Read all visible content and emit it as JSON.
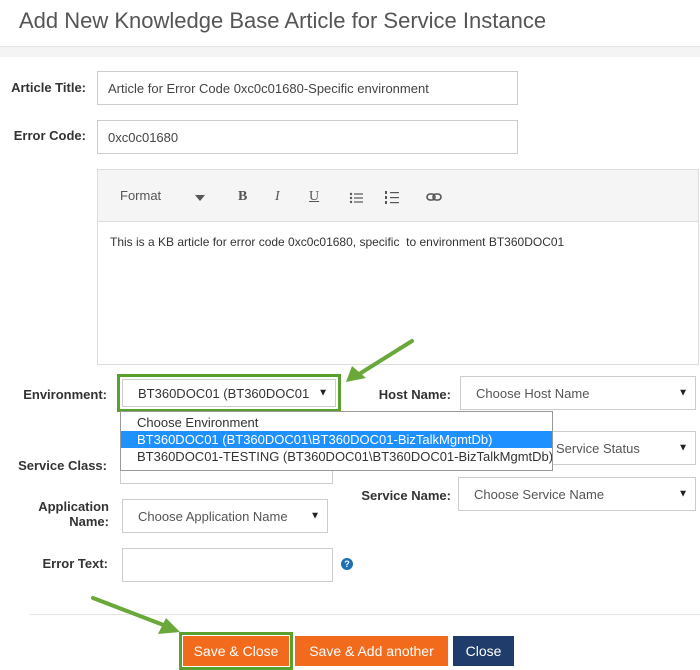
{
  "dialog": {
    "title": "Add New Knowledge Base Article for Service Instance"
  },
  "form": {
    "article_title": {
      "label": "Article Title:",
      "value": "Article for Error Code 0xc0c01680-Specific environment"
    },
    "error_code": {
      "label": "Error Code:",
      "value": "0xc0c01680"
    },
    "editor": {
      "format_label": "Format",
      "bold_glyph": "B",
      "italic_glyph": "I",
      "underline_glyph": "U",
      "content": "This is a KB article for error code 0xc0c01680, specific  to environment BT360DOC01"
    },
    "environment": {
      "label": "Environment:",
      "selected": "BT360DOC01 (BT360DOC01",
      "options": [
        "Choose Environment",
        "BT360DOC01 (BT360DOC01\\BT360DOC01-BizTalkMgmtDb)",
        "BT360DOC01-TESTING (BT360DOC01\\BT360DOC01-BizTalkMgmtDb)"
      ],
      "highlighted_index": 1
    },
    "host_name": {
      "label": "Host Name:",
      "placeholder": "Choose Host Name"
    },
    "service_class": {
      "label": "Service Class:"
    },
    "service_status": {
      "placeholder": "Service Status"
    },
    "service_name": {
      "label": "Service Name:",
      "placeholder": "Choose Service Name"
    },
    "application_name": {
      "label_line1": "Application",
      "label_line2": "Name:",
      "placeholder": "Choose Application Name"
    },
    "error_text": {
      "label": "Error Text:",
      "help_glyph": "?"
    }
  },
  "buttons": {
    "save_close": "Save & Close",
    "save_add_another": "Save & Add another",
    "close": "Close"
  },
  "colors": {
    "accent_orange": "#f26a1b",
    "navy": "#1f3c6a",
    "highlight_green": "#5aa02c",
    "selection_blue": "#1e90ff"
  }
}
